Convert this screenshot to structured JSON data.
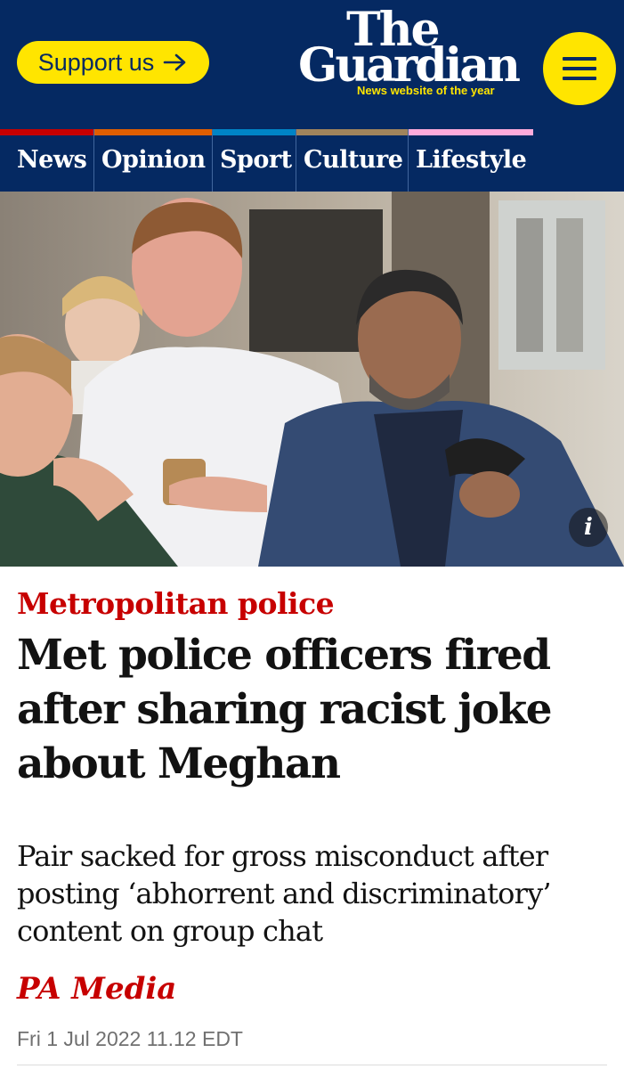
{
  "header": {
    "support_label": "Support us",
    "logo_line1": "The",
    "logo_line2": "Guardian",
    "tagline": "News website of the year"
  },
  "nav": {
    "items": [
      {
        "label": "News",
        "color": "#c70000"
      },
      {
        "label": "Opinion",
        "color": "#e05e00"
      },
      {
        "label": "Sport",
        "color": "#0084c6"
      },
      {
        "label": "Culture",
        "color": "#a1845c"
      },
      {
        "label": "Lifestyle",
        "color": "#ffabdb"
      }
    ]
  },
  "article": {
    "kicker": "Metropolitan police",
    "headline": "Met police officers fired after sharing racist joke about Meghan",
    "standfirst": "Pair sacked for gross misconduct after posting ‘abhorrent and discriminatory’ content on group chat",
    "byline": "PA Media",
    "date": "Fri 1 Jul 2022 11.12 EDT"
  },
  "image": {
    "info_icon": "i"
  },
  "colors": {
    "brand_blue": "#052962",
    "brand_yellow": "#ffe500",
    "news_red": "#c70000"
  }
}
